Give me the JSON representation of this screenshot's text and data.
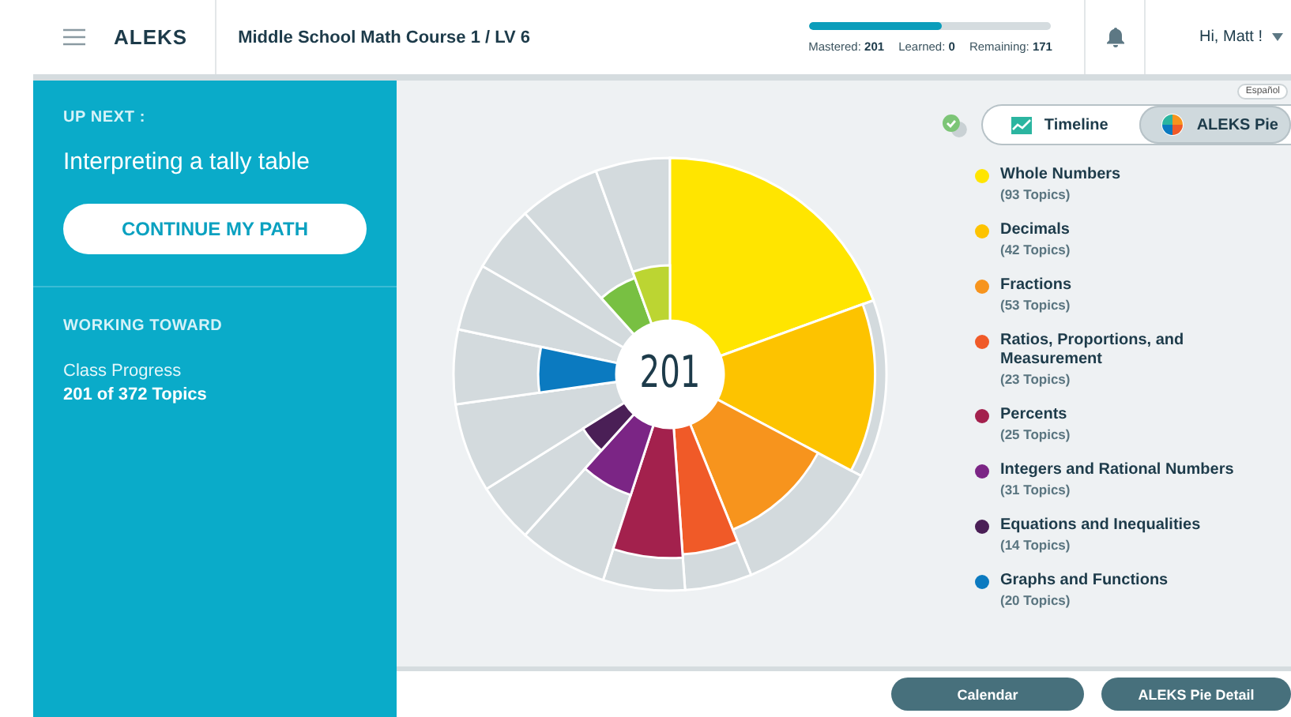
{
  "header": {
    "logo": "ALEKS",
    "course": "Middle School Math Course 1 / LV 6",
    "progress": {
      "level": 0.55,
      "mastered_label": "Mastered:",
      "mastered": "201",
      "learned_label": "Learned:",
      "learned": "0",
      "remaining_label": "Remaining:",
      "remaining": "171"
    },
    "user": "Hi, Matt !"
  },
  "sidebar": {
    "up_next_label": "UP NEXT :",
    "up_next_topic": "Interpreting a tally table",
    "continue_button": "CONTINUE MY PATH",
    "working_toward_label": "WORKING TOWARD",
    "goal_label": "Class Progress",
    "goal_value": "201 of 372 Topics"
  },
  "language_badge": "Español",
  "view_toggle": [
    {
      "label": "Timeline",
      "selected": false
    },
    {
      "label": "ALEKS Pie",
      "selected": true
    }
  ],
  "pie": {
    "center_label": "201"
  },
  "legend": [
    {
      "name": "Whole Numbers",
      "count": "(93 Topics)",
      "color": "#ffe500"
    },
    {
      "name": "Decimals",
      "count": "(42 Topics)",
      "color": "#fdc300"
    },
    {
      "name": "Fractions",
      "count": "(53 Topics)",
      "color": "#f7941d"
    },
    {
      "name": "Ratios, Proportions, and Measurement",
      "count": "(23 Topics)",
      "color": "#f05a28"
    },
    {
      "name": "Percents",
      "count": "(25 Topics)",
      "color": "#a3214d"
    },
    {
      "name": "Integers and Rational Numbers",
      "count": "(31 Topics)",
      "color": "#7b2585"
    },
    {
      "name": "Equations and Inequalities",
      "count": "(14 Topics)",
      "color": "#4a1f56"
    },
    {
      "name": "Graphs and Functions",
      "count": "(20 Topics)",
      "color": "#0b7ac0"
    }
  ],
  "footer_buttons": [
    "Calendar",
    "ALEKS Pie Detail"
  ]
}
